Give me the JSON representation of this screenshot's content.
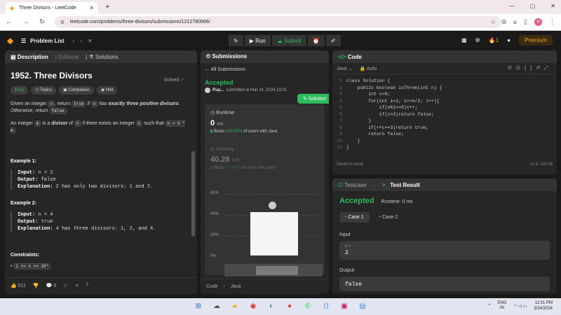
{
  "browser": {
    "tab_title": "Three Divisors - LeetCode",
    "url": "leetcode.com/problems/three-divisors/submissions/1212780566/",
    "new_tab": "+"
  },
  "nav": {
    "problem_list": "Problem List",
    "run": "Run",
    "submit": "Submit",
    "streak": "1",
    "premium": "Premium"
  },
  "description": {
    "tabs": [
      "Description",
      "Editorial",
      "Solutions"
    ],
    "title": "1952. Three Divisors",
    "solved": "Solved",
    "tags": [
      "Easy",
      "Topics",
      "Companies",
      "Hint"
    ],
    "p1_a": "Given an integer ",
    "p1_n": "n",
    "p1_b": ", return ",
    "p1_true": "true",
    "p1_c": " if ",
    "p1_n2": "n",
    "p1_d": " has ",
    "p1_em": "exactly three positive divisors",
    "p1_e": ". Otherwise, return ",
    "p1_false": "false",
    "p1_f": ".",
    "p2_a": "An integer ",
    "p2_m": "m",
    "p2_b": " is a ",
    "p2_bold": "divisor",
    "p2_c": " of ",
    "p2_n": "n",
    "p2_d": " if there exists an integer ",
    "p2_k": "k",
    "p2_e": " such that ",
    "p2_eq": "n = k * m",
    "p2_f": ".",
    "ex1_title": "Example 1:",
    "ex1_input": "n = 2",
    "ex1_output": "false",
    "ex1_expl": "2 has only two divisors: 1 and 2.",
    "ex2_title": "Example 2:",
    "ex2_input": "n = 4",
    "ex2_output": "true",
    "ex2_expl": "4 has three divisors: 1, 2, and 4.",
    "input_lbl": "Input:",
    "output_lbl": "Output:",
    "expl_lbl": "Explanation:",
    "constraints_title": "Constraints:",
    "constraint": "1 <= n <= 10⁴",
    "likes": "511",
    "comments": "9"
  },
  "submissions": {
    "header": "Submissions",
    "back": "All Submissions",
    "status": "Accepted",
    "user": "Rup...",
    "submitted": "submitted at Mar 24, 2024 23:01",
    "solution_btn": "Solution",
    "runtime_label": "Runtime",
    "runtime_value": "0",
    "runtime_unit": "ms",
    "runtime_beats_pre": "Beats",
    "runtime_beats_pct": "100.00%",
    "runtime_beats_post": "of users with Java",
    "memory_label": "Memory",
    "memory_value": "40.28",
    "memory_unit": "MB",
    "memory_beats_pre": "Beats",
    "memory_beats_pct": "63.98%",
    "memory_beats_post": "of users with Java",
    "yticks": [
      "60%",
      "40%",
      "20%",
      "0%"
    ],
    "footer_code": "Code",
    "footer_lang": "Java"
  },
  "code": {
    "header": "Code",
    "lang": "Java",
    "mode": "Auto",
    "line_numbers": [
      "1",
      "2",
      "3",
      "4",
      "5",
      "6",
      "7",
      "8",
      "9",
      "10",
      "11"
    ],
    "lines": [
      "class Solution {",
      "    public boolean isThree(int n) {",
      "        int c=0;",
      "        for(int i=1; i<=n/2; i++){",
      "            if(n%i==0)c++;",
      "            if(c>3)return false;",
      "        }",
      "        if(++c==3)return true;",
      "        return false;",
      "    }",
      "}"
    ],
    "saved": "Saved to local",
    "cursor": "Ln 8, Col 14"
  },
  "testcase": {
    "tab1": "Testcase",
    "tab2": "Test Result",
    "status": "Accepted",
    "runtime": "Runtime: 0 ms",
    "cases": [
      "Case 1",
      "Case 2"
    ],
    "input_label": "Input",
    "input_key": "n =",
    "input_value": "2",
    "output_label": "Output",
    "output_value": "false"
  },
  "taskbar": {
    "lang1": "ENG",
    "lang2": "IN",
    "time": "11:01 PM",
    "date": "3/24/2024"
  },
  "colors": {
    "accent_green": "#2cbb5d",
    "brand_orange": "#f89f1b"
  }
}
